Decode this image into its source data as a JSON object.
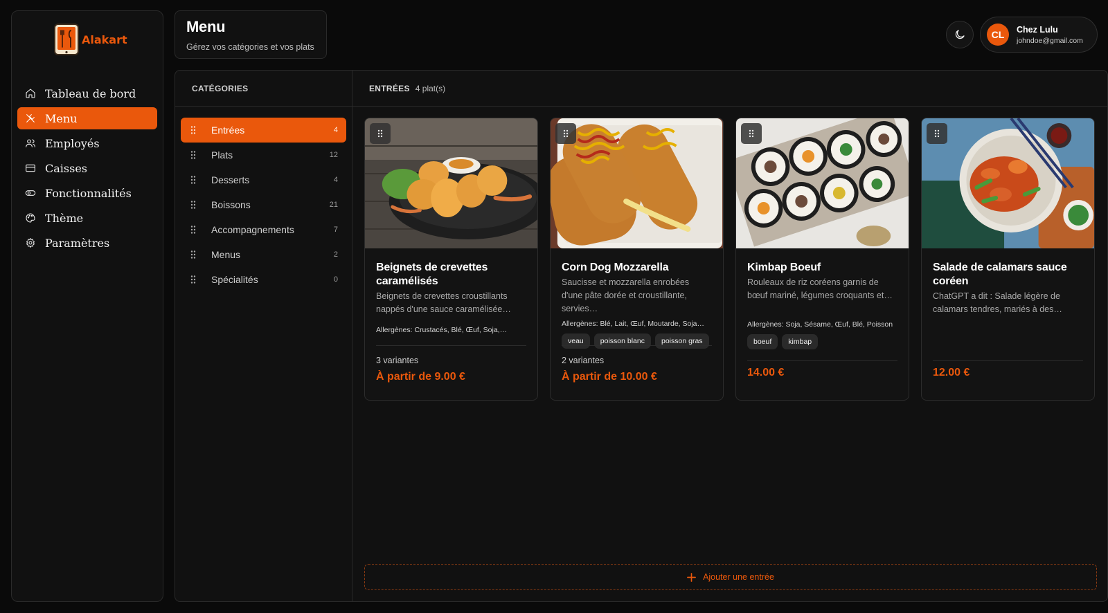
{
  "app": {
    "name": "Alakart"
  },
  "sidebar": {
    "items": [
      {
        "label": "Tableau de bord",
        "icon": "home-icon"
      },
      {
        "label": "Menu",
        "icon": "utensils-icon",
        "active": true
      },
      {
        "label": "Employés",
        "icon": "users-icon"
      },
      {
        "label": "Caisses",
        "icon": "credit-card-icon"
      },
      {
        "label": "Fonctionnalités",
        "icon": "toggle-icon"
      },
      {
        "label": "Thème",
        "icon": "palette-icon"
      },
      {
        "label": "Paramètres",
        "icon": "gear-icon"
      }
    ]
  },
  "header": {
    "title": "Menu",
    "subtitle": "Gérez vos catégories et vos plats"
  },
  "user": {
    "initials": "CL",
    "name": "Chez Lulu",
    "email": "johndoe@gmail.com"
  },
  "categories": {
    "header": "CATÉGORIES",
    "items": [
      {
        "label": "Entrées",
        "count": "4",
        "active": true
      },
      {
        "label": "Plats",
        "count": "12"
      },
      {
        "label": "Desserts",
        "count": "4"
      },
      {
        "label": "Boissons",
        "count": "21"
      },
      {
        "label": "Accompagnements",
        "count": "7"
      },
      {
        "label": "Menus",
        "count": "2"
      },
      {
        "label": "Spécialités",
        "count": "0"
      }
    ]
  },
  "dishes": {
    "header_title": "ENTRÉES",
    "header_count": "4 plat(s)",
    "add_label": "Ajouter une entrée",
    "accent": "#ea580c",
    "items": [
      {
        "title": "Beignets de crevettes caramélisés",
        "description": "Beignets de crevettes croustillants nappés d'une sauce caramélisée…",
        "allergens": "Allergènes: Crustacés, Blé, Œuf, Soja,…",
        "tags": [],
        "variants": "3 variantes",
        "price": "À partir de 9.00 €"
      },
      {
        "title": "Corn Dog Mozzarella",
        "description": "Saucisse et mozzarella enrobées d'une pâte dorée et croustillante, servies…",
        "allergens": "Allergènes: Blé, Lait, Œuf, Moutarde, Soja…",
        "tags": [
          "veau",
          "poisson blanc",
          "poisson gras"
        ],
        "variants": "2 variantes",
        "price": "À partir de 10.00 €"
      },
      {
        "title": "Kimbap Boeuf",
        "description": "Rouleaux de riz coréens garnis de bœuf mariné, légumes croquants et…",
        "allergens": "Allergènes: Soja, Sésame, Œuf, Blé, Poisson",
        "tags": [
          "boeuf",
          "kimbap"
        ],
        "variants": "",
        "price": "14.00 €"
      },
      {
        "title": "Salade de calamars sauce coréen",
        "description": "ChatGPT a dit : Salade légère de calamars tendres, mariés à des…",
        "allergens": "",
        "tags": [],
        "variants": "",
        "price": "12.00 €"
      }
    ]
  }
}
